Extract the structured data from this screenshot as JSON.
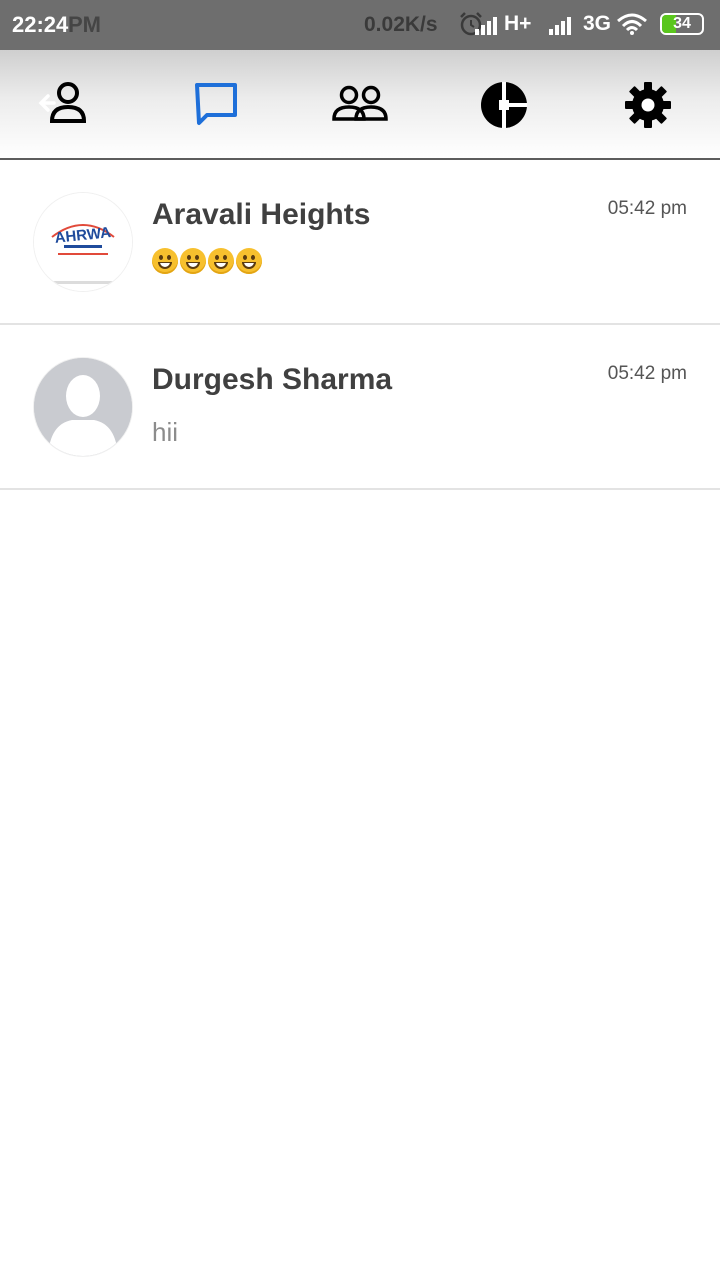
{
  "status_bar": {
    "time": "22:24",
    "ghost_text": "PM",
    "net_speed": "0.02K/s",
    "network_1": "H+",
    "network_2": "3G",
    "battery": "34",
    "battery_level_percent": 34,
    "icons": [
      "alarm-icon",
      "signal-icon",
      "signal-icon",
      "wifi-icon",
      "battery-icon"
    ]
  },
  "toolbar": {
    "tabs": [
      {
        "name": "profile",
        "icon": "profile-back-icon",
        "active": false
      },
      {
        "name": "chats",
        "icon": "chat-bubble-icon",
        "active": true
      },
      {
        "name": "groups",
        "icon": "group-icon",
        "active": false
      },
      {
        "name": "status",
        "icon": "pie-icon",
        "active": false
      },
      {
        "name": "settings",
        "icon": "gear-icon",
        "active": false
      }
    ],
    "active_color": "#1e6fd9",
    "icon_color": "#000000"
  },
  "chats": [
    {
      "name": "Aravali Heights",
      "time": "05:42 pm",
      "preview": "😀😀😀😀",
      "avatar": "ahrwa-logo",
      "avatar_text": "AHRWA"
    },
    {
      "name": "Durgesh Sharma",
      "time": "05:42 pm",
      "preview": "hii",
      "avatar": "default-person-avatar"
    }
  ]
}
